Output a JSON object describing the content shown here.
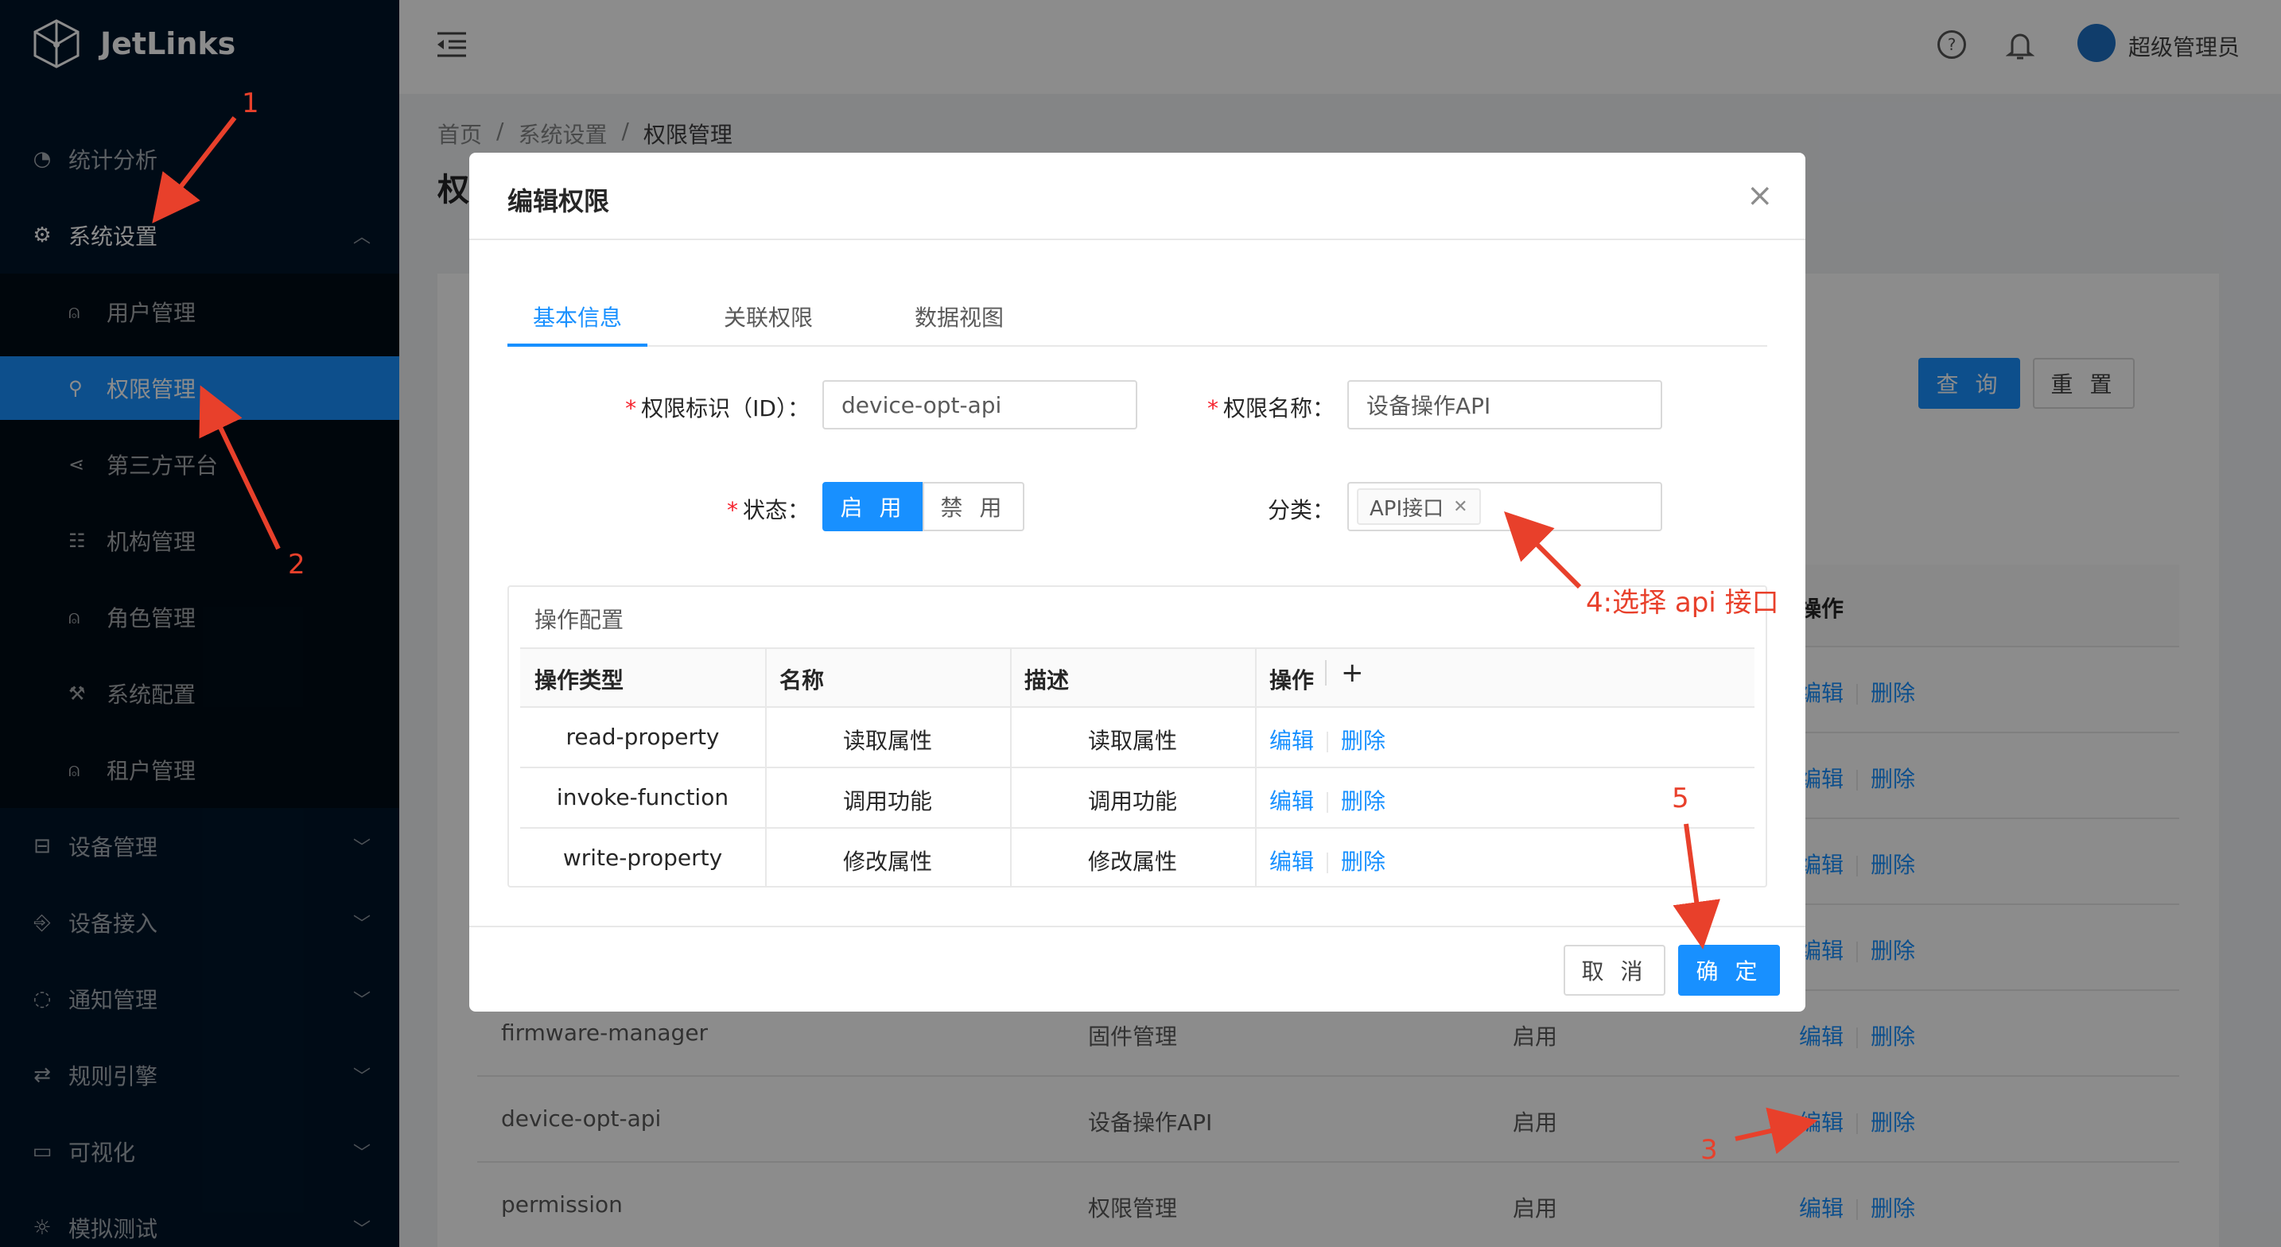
{
  "app": {
    "name": "JetLinks"
  },
  "sidebar": {
    "items": [
      {
        "icon": "dashboard-icon",
        "label": "统计分析"
      },
      {
        "icon": "gear-icon",
        "label": "系统设置"
      },
      {
        "icon": "device-icon",
        "label": "设备管理"
      },
      {
        "icon": "login-icon",
        "label": "设备接入"
      },
      {
        "icon": "message-icon",
        "label": "通知管理"
      },
      {
        "icon": "retweet-icon",
        "label": "规则引擎"
      },
      {
        "icon": "desktop-icon",
        "label": "可视化"
      },
      {
        "icon": "bug-icon",
        "label": "模拟测试"
      }
    ],
    "submenu": [
      {
        "icon": "user-icon",
        "label": "用户管理"
      },
      {
        "icon": "key-icon",
        "label": "权限管理"
      },
      {
        "icon": "share-icon",
        "label": "第三方平台"
      },
      {
        "icon": "org-icon",
        "label": "机构管理"
      },
      {
        "icon": "team-icon",
        "label": "角色管理"
      },
      {
        "icon": "tool-icon",
        "label": "系统配置"
      },
      {
        "icon": "team-icon",
        "label": "租户管理"
      }
    ]
  },
  "header": {
    "username": "超级管理员",
    "help_icon": "?"
  },
  "breadcrumb": {
    "items": [
      "首页",
      "系统设置",
      "权限管理"
    ],
    "sep": "/"
  },
  "page": {
    "title": "权",
    "query_button": "查 询",
    "reset_button": "重 置",
    "table_header_action": "操作",
    "action_edit": "编辑",
    "action_delete": "删除",
    "rows": [
      {
        "id": "firmware-manager",
        "name": "固件管理",
        "status": "启用"
      },
      {
        "id": "device-opt-api",
        "name": "设备操作API",
        "status": "启用"
      },
      {
        "id": "permission",
        "name": "权限管理",
        "status": "启用"
      }
    ]
  },
  "modal": {
    "title": "编辑权限",
    "close": "×",
    "tabs": [
      "基本信息",
      "关联权限",
      "数据视图"
    ],
    "form": {
      "id_label": "权限标识（ID）：",
      "id_value": "device-opt-api",
      "name_label": "权限名称：",
      "name_value": "设备操作API",
      "status_label": "状态：",
      "status_on": "启 用",
      "status_off": "禁 用",
      "category_label": "分类：",
      "category_tag": "API接口",
      "required_mark": "*"
    },
    "ops": {
      "title": "操作配置",
      "columns": [
        "操作类型",
        "名称",
        "描述",
        "操作"
      ],
      "add": "+",
      "edit": "编辑",
      "delete": "删除",
      "rows": [
        {
          "type": "read-property",
          "name": "读取属性",
          "desc": "读取属性"
        },
        {
          "type": "invoke-function",
          "name": "调用功能",
          "desc": "调用功能"
        },
        {
          "type": "write-property",
          "name": "修改属性",
          "desc": "修改属性"
        }
      ]
    },
    "cancel": "取 消",
    "ok": "确 定"
  },
  "annotations": {
    "n1": "1",
    "n2": "2",
    "n3": "3",
    "n4": "4:选择 api 接口",
    "n5": "5",
    "color": "#e8402b"
  }
}
